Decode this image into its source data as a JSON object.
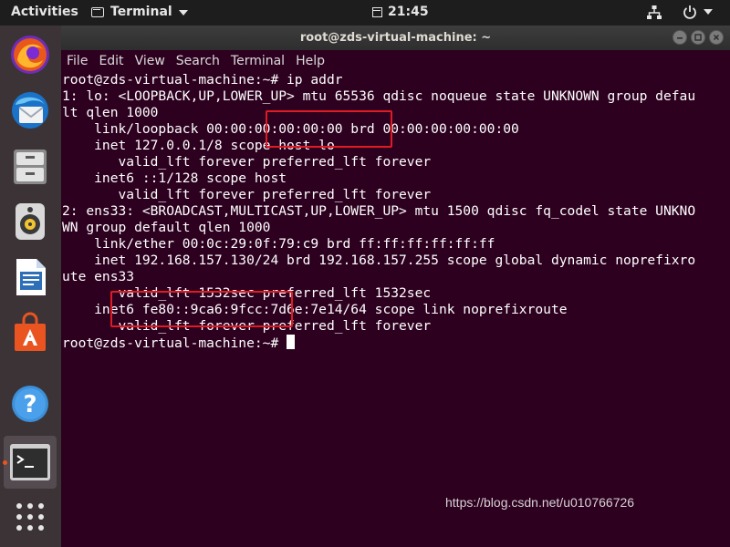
{
  "topbar": {
    "activities": "Activities",
    "app_name": "Terminal",
    "time": "21:45",
    "icons": [
      "terminal-icon",
      "calendar-icon",
      "network-icon",
      "power-icon",
      "chevron-down-icon"
    ]
  },
  "dock": {
    "items": [
      {
        "name": "firefox",
        "icon": "firefox-icon"
      },
      {
        "name": "thunderbird",
        "icon": "thunderbird-icon"
      },
      {
        "name": "files",
        "icon": "files-icon"
      },
      {
        "name": "rhythmbox",
        "icon": "rhythmbox-icon"
      },
      {
        "name": "libreoffice-writer",
        "icon": "writer-icon"
      },
      {
        "name": "ubuntu-software",
        "icon": "software-center-icon"
      },
      {
        "name": "help",
        "icon": "help-icon"
      },
      {
        "name": "terminal",
        "icon": "terminal-icon",
        "active": true
      },
      {
        "name": "show-applications",
        "icon": "app-grid-icon"
      }
    ]
  },
  "window": {
    "title": "root@zds-virtual-machine: ~",
    "menu": [
      "File",
      "Edit",
      "View",
      "Search",
      "Terminal",
      "Help"
    ]
  },
  "terminal": {
    "lines": [
      "root@zds-virtual-machine:~# ip addr",
      "1: lo: <LOOPBACK,UP,LOWER_UP> mtu 65536 qdisc noqueue state UNKNOWN group defau",
      "lt qlen 1000",
      "    link/loopback 00:00:00:00:00:00 brd 00:00:00:00:00:00",
      "    inet 127.0.0.1/8 scope host lo",
      "       valid_lft forever preferred_lft forever",
      "    inet6 ::1/128 scope host",
      "       valid_lft forever preferred_lft forever",
      "2: ens33: <BROADCAST,MULTICAST,UP,LOWER_UP> mtu 1500 qdisc fq_codel state UNKNO",
      "WN group default qlen 1000",
      "    link/ether 00:0c:29:0f:79:c9 brd ff:ff:ff:ff:ff:ff",
      "    inet 192.168.157.130/24 brd 192.168.157.255 scope global dynamic noprefixro",
      "ute ens33",
      "       valid_lft 1532sec preferred_lft 1532sec",
      "    inet6 fe80::9ca6:9fcc:7d6e:7e14/64 scope link noprefixroute",
      "       valid_lft forever preferred_lft forever"
    ],
    "prompt": "root@zds-virtual-machine:~# "
  },
  "annotations": {
    "box_color": "#e01b24"
  },
  "watermark": "https://blog.csdn.net/u010766726",
  "colors": {
    "terminal_bg": "#2c001e",
    "dock_bg": "#3c3337",
    "topbar_bg": "#1d1d1d",
    "accent": "#e95420"
  }
}
